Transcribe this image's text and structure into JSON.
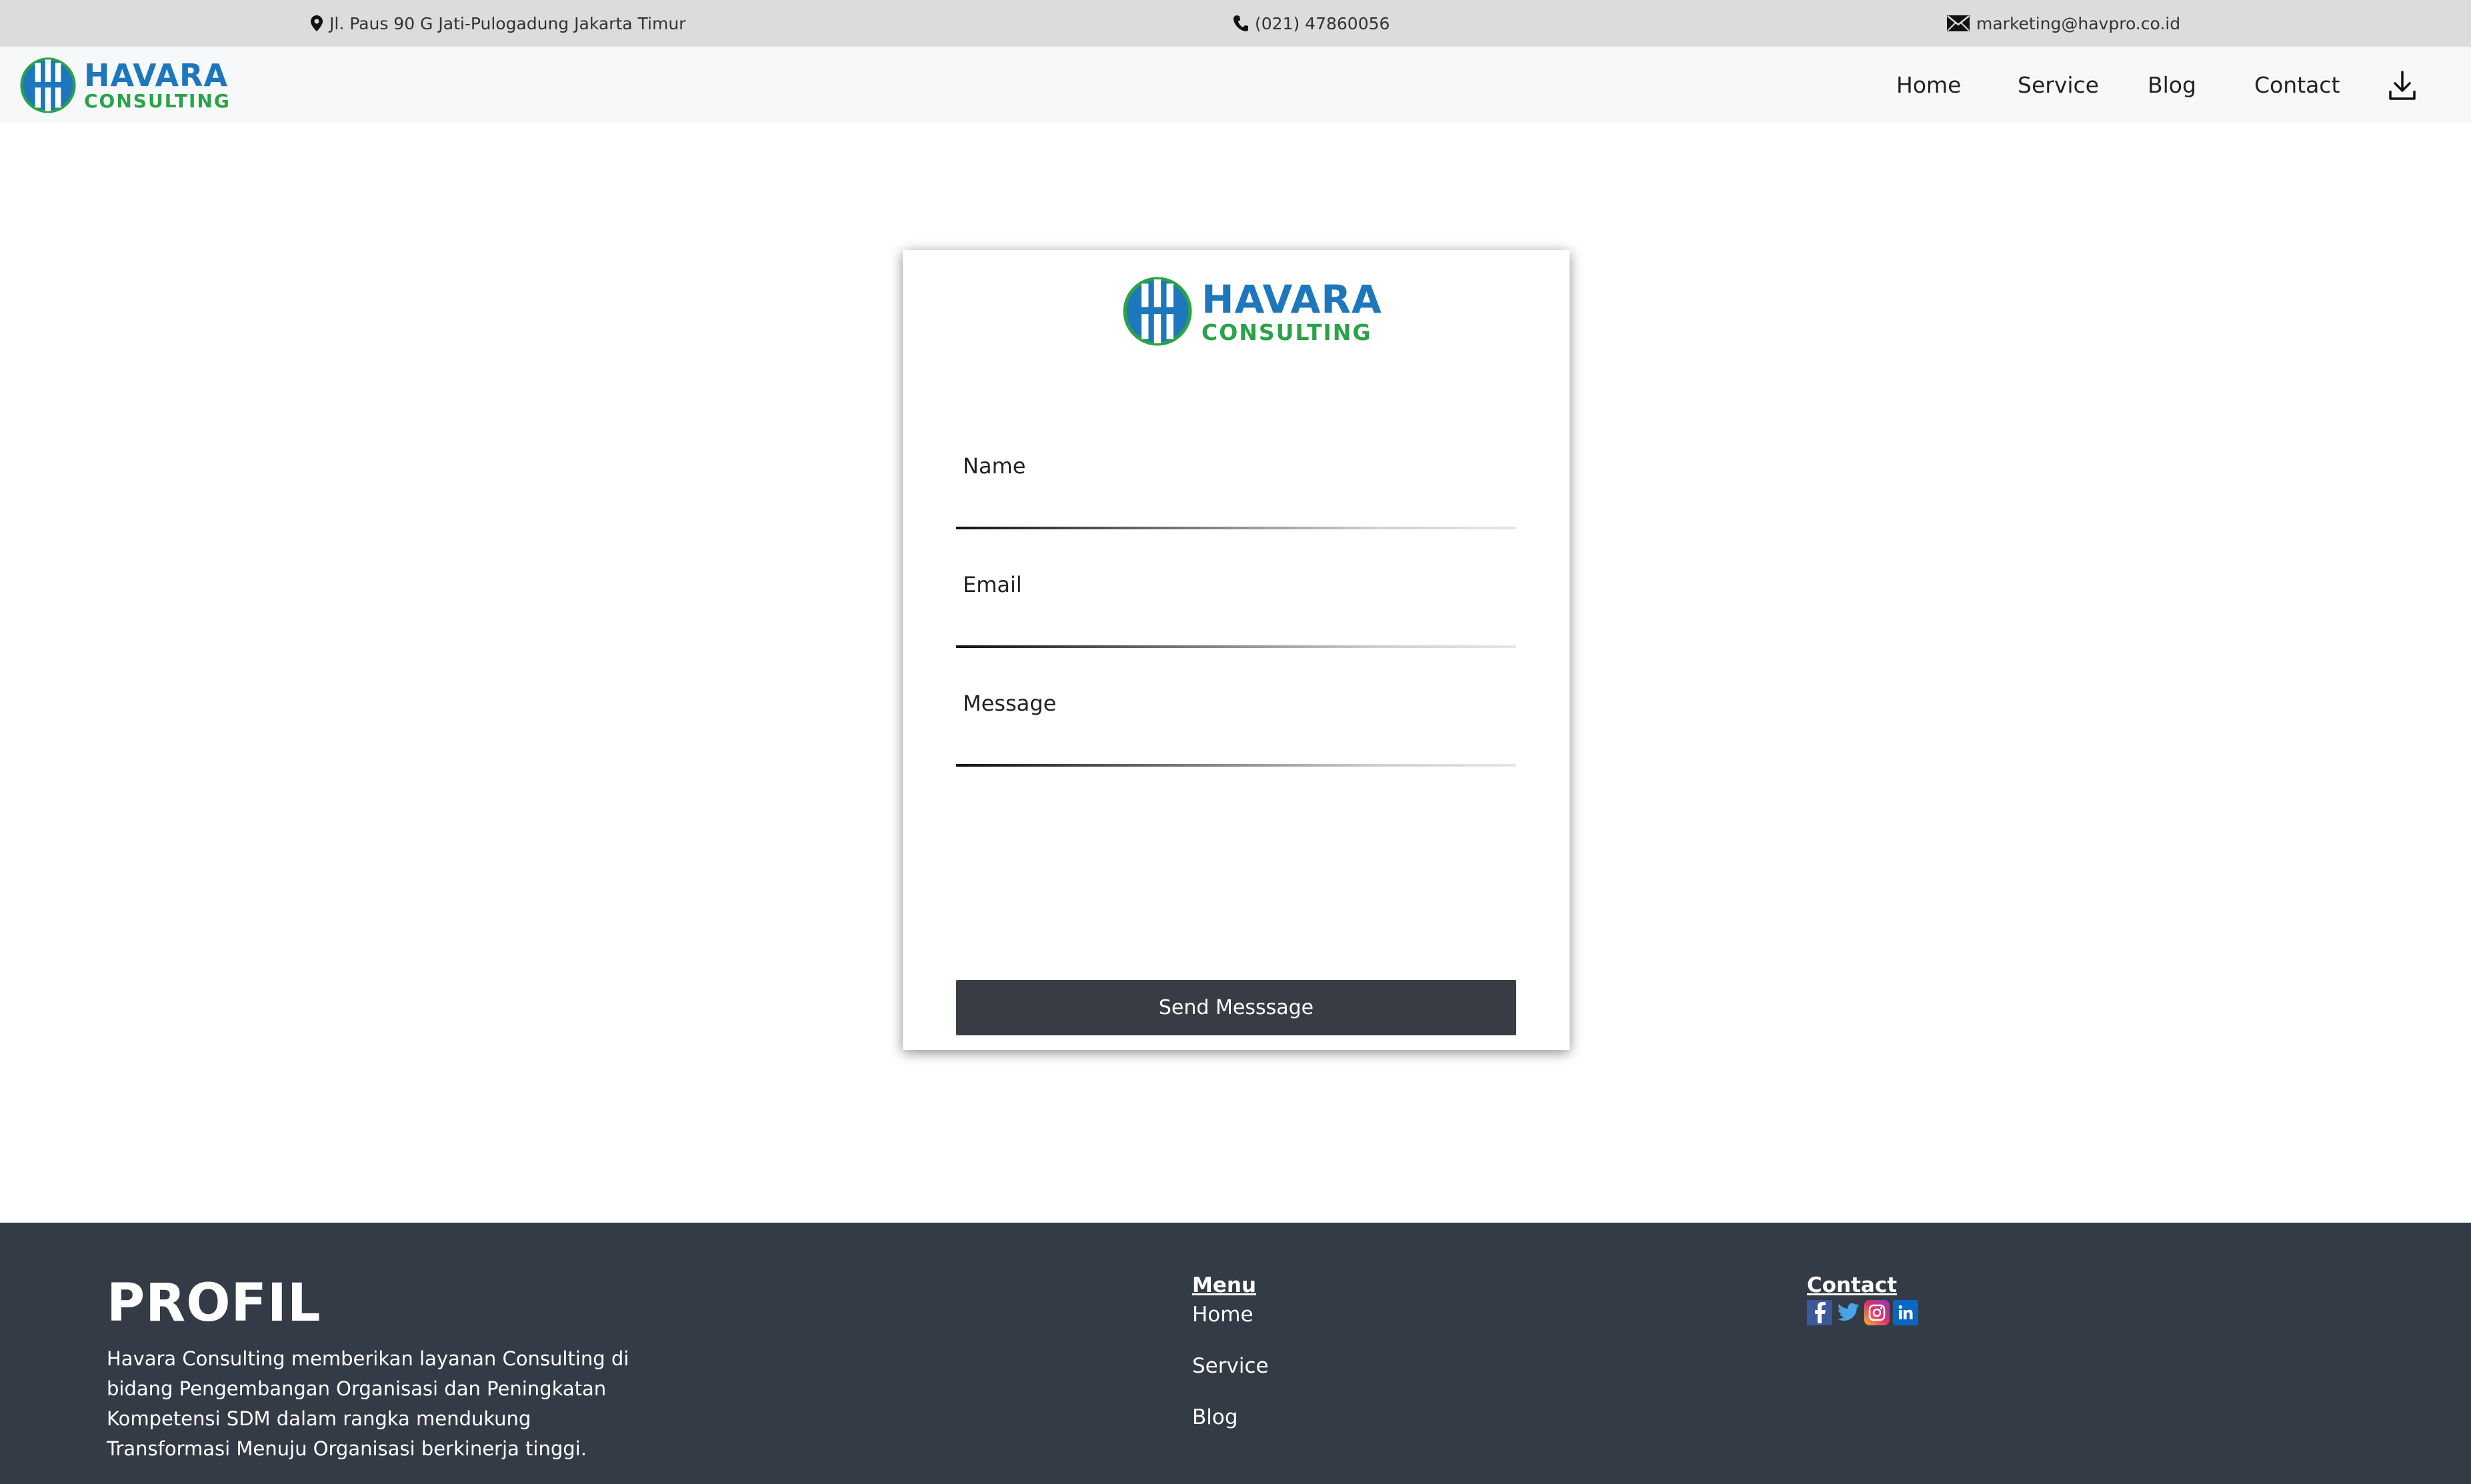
{
  "topbar": {
    "address": "Jl. Paus 90 G Jati-Pulogadung Jakarta Timur",
    "phone": "(021) 47860056",
    "email": "marketing@havpro.co.id"
  },
  "brand": {
    "line1": "HAVARA",
    "line2": "CONSULTING",
    "blue": "#1d77bd",
    "green": "#2aa348"
  },
  "nav": {
    "items": [
      {
        "label": "Home"
      },
      {
        "label": "Service"
      },
      {
        "label": "Blog"
      },
      {
        "label": "Contact"
      }
    ],
    "download_icon": "download-icon"
  },
  "form": {
    "name_label": "Name",
    "email_label": "Email",
    "message_label": "Message",
    "name_value": "",
    "email_value": "",
    "message_value": "",
    "submit_label": "Send Messsage",
    "button_color": "#383c45"
  },
  "footer": {
    "profile_title": "PROFIL",
    "profile_text": "Havara Consulting memberikan layanan Consulting di bidang Pengembangan Organisasi dan Peningkatan Kompetensi SDM dalam rangka mendukung Transformasi Menuju Organisasi berkinerja tinggi.",
    "menu_heading": "Menu",
    "menu_items": [
      {
        "label": "Home"
      },
      {
        "label": "Service"
      },
      {
        "label": "Blog"
      }
    ],
    "contact_heading": "Contact",
    "socials": [
      "facebook-icon",
      "twitter-icon",
      "instagram-icon",
      "linkedin-icon"
    ],
    "background": "#333b47"
  }
}
